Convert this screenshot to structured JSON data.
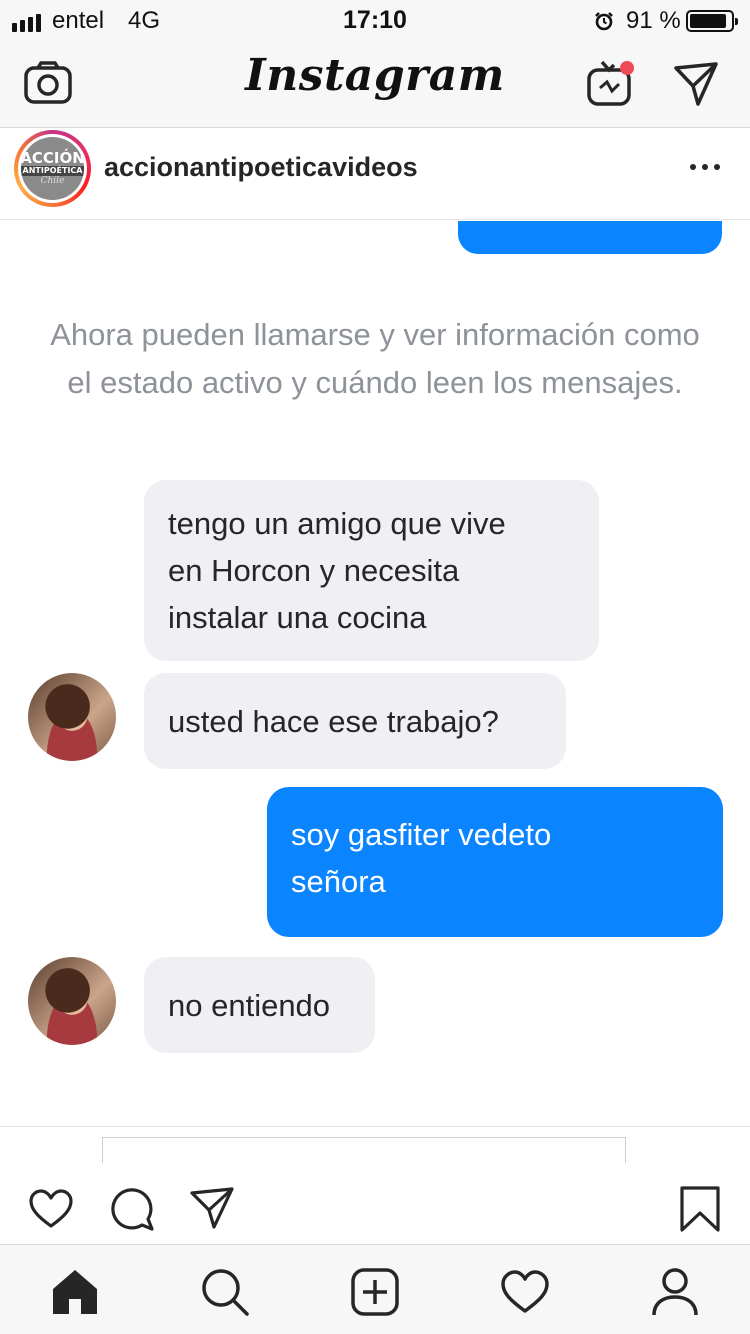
{
  "status_bar": {
    "carrier": "entel",
    "network": "4G",
    "time": "17:10",
    "battery_percent": "91 %",
    "battery_level": 0.91,
    "icons": [
      "signal-icon",
      "alarm-icon",
      "battery-icon"
    ]
  },
  "top_bar": {
    "logo": "Instagram",
    "icons": [
      "camera-icon",
      "igtv-icon",
      "direct-message-icon"
    ],
    "notification_dot_color": "#ed4956"
  },
  "post": {
    "username": "accionantipoeticavideos",
    "avatar_lines": [
      "ACCIÓN",
      "ANTIPOÉTICA",
      "Chile"
    ]
  },
  "chat": {
    "system_message_line1": "Ahora pueden llamarse y ver información como",
    "system_message_line2": "el estado activo y cuándo leen los mensajes.",
    "messages": [
      {
        "from": "other",
        "lines": [
          "tengo un amigo que vive",
          "en Horcon y necesita",
          "instalar una cocina"
        ]
      },
      {
        "from": "other",
        "lines": [
          "usted hace ese trabajo?"
        ]
      },
      {
        "from": "me",
        "lines": [
          "soy gasfiter vedeto",
          "señora"
        ]
      },
      {
        "from": "other",
        "lines": [
          "no entiendo"
        ]
      }
    ],
    "bubble_colors": {
      "incoming": "#efeff4",
      "outgoing": "#0a84ff"
    }
  },
  "actions": {
    "icons": [
      "like-heart-icon",
      "comment-icon",
      "share-icon",
      "bookmark-icon"
    ]
  },
  "tab_bar": {
    "icons": [
      "home-icon",
      "search-icon",
      "new-post-icon",
      "activity-heart-icon",
      "profile-icon"
    ]
  }
}
